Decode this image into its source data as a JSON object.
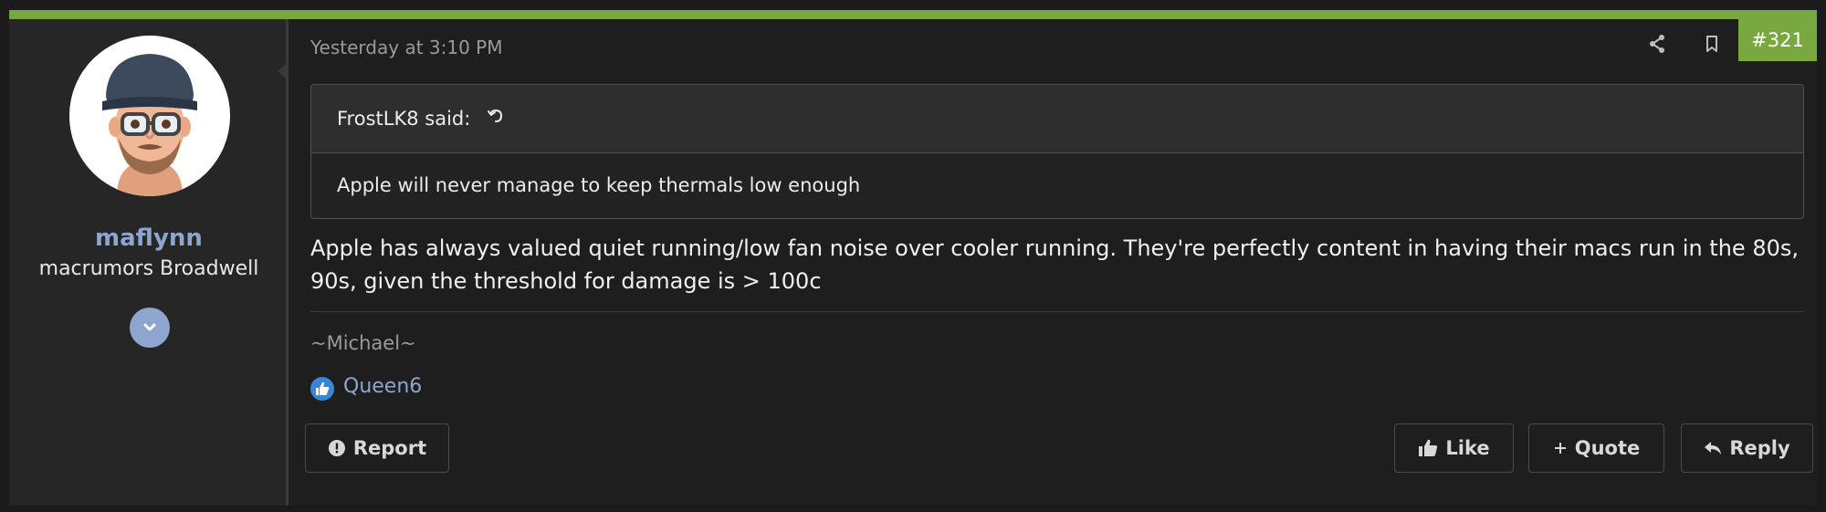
{
  "post": {
    "date": "Yesterday at 3:10 PM",
    "number": "#321",
    "share_icon": "share-icon",
    "bookmark_icon": "bookmark-icon"
  },
  "author": {
    "name": "maflynn",
    "title": "macrumors Broadwell",
    "avatar_icon": "memoji-avatar",
    "expand_icon": "chevron-down-icon"
  },
  "quote": {
    "author_label": "FrostLK8 said:",
    "jump_icon": "undo-arrow-icon",
    "text": "Apple will never manage to keep thermals low enough"
  },
  "message": {
    "text": "Apple has always valued quiet running/low fan noise over cooler running. They're perfectly content in having their macs run in the 80s, 90s, given the threshold for damage is > 100c"
  },
  "signature": "~Michael~",
  "reactions": {
    "icon": "thumbs-up-icon",
    "users": "Queen6"
  },
  "actions": {
    "report": "Report",
    "like": "Like",
    "quote": "Quote",
    "reply": "Reply"
  },
  "colors": {
    "accent": "#79a841",
    "username": "#8ea6cf",
    "background": "#1e1e1e",
    "reaction_badge": "#3a86d6"
  }
}
